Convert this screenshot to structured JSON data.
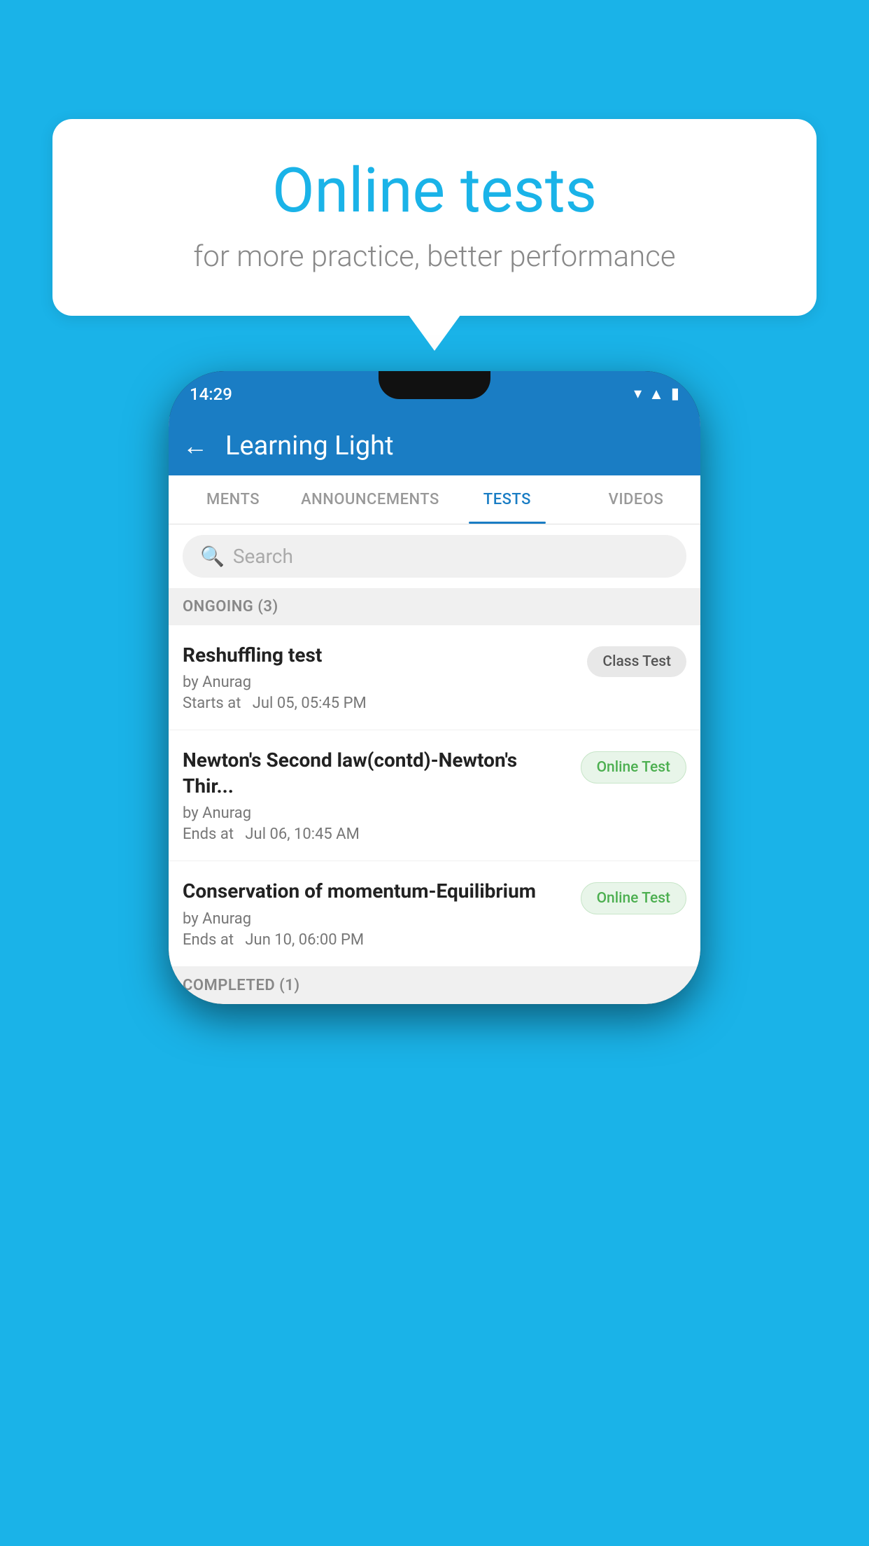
{
  "background_color": "#1ab3e8",
  "bubble": {
    "title": "Online tests",
    "subtitle": "for more practice, better performance"
  },
  "phone": {
    "time": "14:29",
    "app_title": "Learning Light",
    "back_label": "←",
    "tabs": [
      {
        "id": "ments",
        "label": "MENTS",
        "active": false
      },
      {
        "id": "announcements",
        "label": "ANNOUNCEMENTS",
        "active": false
      },
      {
        "id": "tests",
        "label": "TESTS",
        "active": true
      },
      {
        "id": "videos",
        "label": "VIDEOS",
        "active": false
      }
    ],
    "search_placeholder": "Search",
    "section_ongoing": "ONGOING (3)",
    "section_completed": "COMPLETED (1)",
    "tests": [
      {
        "id": "test1",
        "title": "Reshuffling test",
        "author": "by Anurag",
        "time_label": "Starts at",
        "time": "Jul 05, 05:45 PM",
        "badge": "Class Test",
        "badge_type": "class"
      },
      {
        "id": "test2",
        "title": "Newton's Second law(contd)-Newton's Thir...",
        "author": "by Anurag",
        "time_label": "Ends at",
        "time": "Jul 06, 10:45 AM",
        "badge": "Online Test",
        "badge_type": "online"
      },
      {
        "id": "test3",
        "title": "Conservation of momentum-Equilibrium",
        "author": "by Anurag",
        "time_label": "Ends at",
        "time": "Jun 10, 06:00 PM",
        "badge": "Online Test",
        "badge_type": "online"
      }
    ]
  }
}
